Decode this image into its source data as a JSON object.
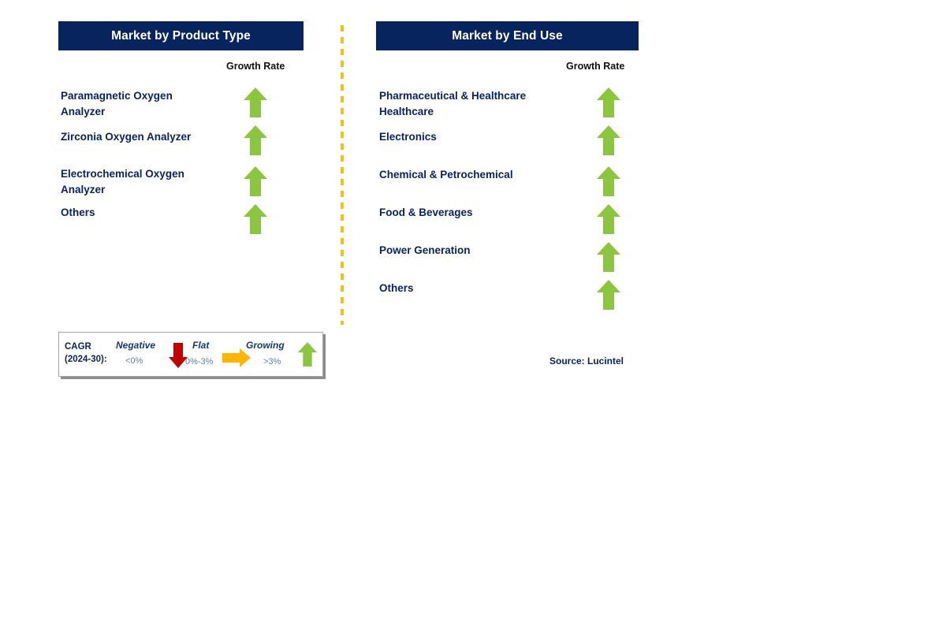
{
  "panels": [
    {
      "id": "product-type",
      "title": "Market by Product Type",
      "growth_rate_label": "Growth Rate",
      "items": [
        {
          "label": "Paramagnetic Oxygen\n Analyzer",
          "growth": "growing",
          "icon": "arrow-up-icon"
        },
        {
          "label": "Zirconia Oxygen Analyzer",
          "growth": "growing",
          "icon": "arrow-up-icon"
        },
        {
          "label": "Electrochemical Oxygen\nAnalyzer",
          "growth": "growing",
          "icon": "arrow-up-icon"
        },
        {
          "label": "Others",
          "growth": "growing",
          "icon": "arrow-up-icon"
        }
      ]
    },
    {
      "id": "end-use",
      "title": "Market by End Use",
      "growth_rate_label": "Growth Rate",
      "items": [
        {
          "label": "Pharmaceutical & Healthcare\nHealthcare",
          "growth": "growing",
          "icon": "arrow-up-icon"
        },
        {
          "label": "Electronics",
          "growth": "growing",
          "icon": "arrow-up-icon"
        },
        {
          "label": "Chemical & Petrochemical",
          "growth": "growing",
          "icon": "arrow-up-icon"
        },
        {
          "label": "Food & Beverages",
          "growth": "growing",
          "icon": "arrow-up-icon"
        },
        {
          "label": "Power Generation",
          "growth": "growing",
          "icon": "arrow-up-icon"
        },
        {
          "label": "Others",
          "growth": "growing",
          "icon": "arrow-up-icon"
        }
      ]
    }
  ],
  "legend": {
    "title": "CAGR\n(2024-30):",
    "entries": [
      {
        "term": "Negative",
        "range": "<0%",
        "icon": "arrow-down-icon",
        "color": "#c00000"
      },
      {
        "term": "Flat",
        "range": "0%-3%",
        "icon": "arrow-right-icon",
        "color": "#ffb600"
      },
      {
        "term": "Growing",
        "range": ">3%",
        "icon": "arrow-up-icon",
        "color": "#8cc63e"
      }
    ]
  },
  "source": "Source: Lucintel",
  "colors": {
    "header_navy": "#08245e",
    "text_navy": "#0b2265",
    "growing_green": "#8cc63e",
    "negative_red": "#c00000",
    "flat_orange": "#ffb600",
    "divider_amber": "#fbbf10"
  }
}
